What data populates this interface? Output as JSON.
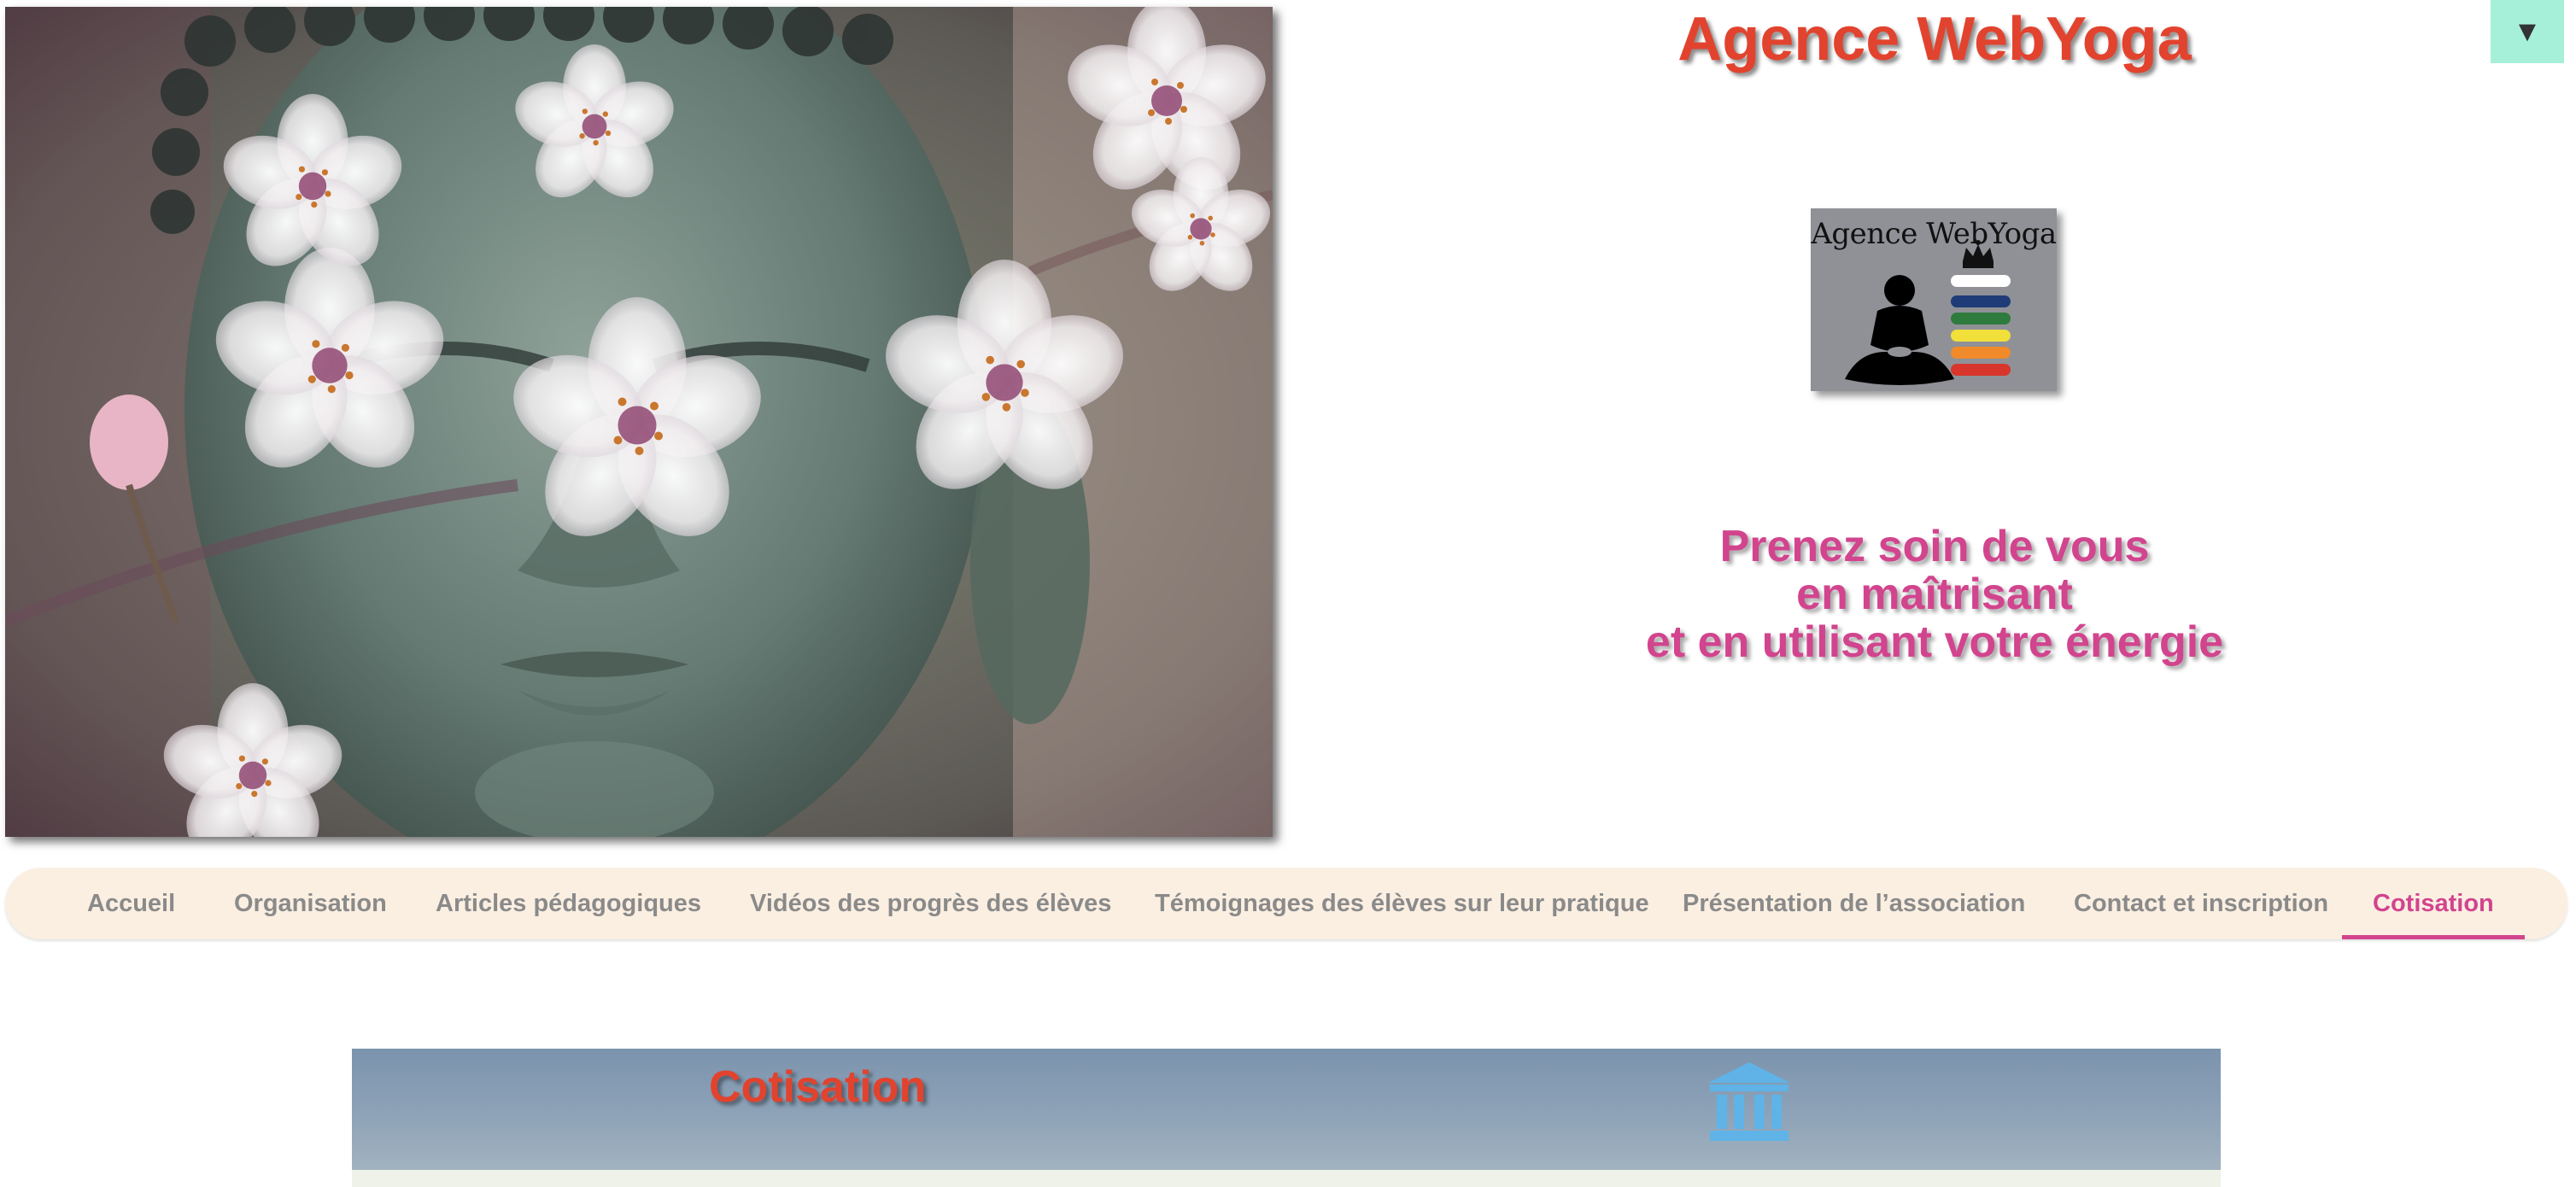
{
  "header": {
    "site_title": "Agence WebYoga",
    "menu_toggle_symbol": "▼",
    "logo_text": "Agence WebYoga",
    "tagline": [
      "Prenez soin de vous",
      "en maîtrisant",
      "et en utilisant votre énergie"
    ]
  },
  "hero": {
    "image_subject": "buddha-face-with-cherry-blossoms"
  },
  "nav": {
    "items": [
      {
        "label": "Accueil"
      },
      {
        "label": "Organisation"
      },
      {
        "label": "Articles pédagogiques"
      },
      {
        "label": "Vidéos des progrès des élèves"
      },
      {
        "label": "Témoignages des élèves sur leur pratique"
      },
      {
        "label": "Présentation de l’association"
      },
      {
        "label": "Contact et inscription"
      },
      {
        "label": "Cotisation",
        "active": true
      }
    ]
  },
  "section": {
    "title": "Cotisation",
    "icon": "bank-icon"
  },
  "colors": {
    "title_red": "#e2432e",
    "accent_pink": "#d2448e",
    "toggle_mint": "#a6f0d9",
    "nav_bg": "#fbefe2",
    "banner_blue": "#7b93ad",
    "icon_blue": "#5fb3e6"
  }
}
